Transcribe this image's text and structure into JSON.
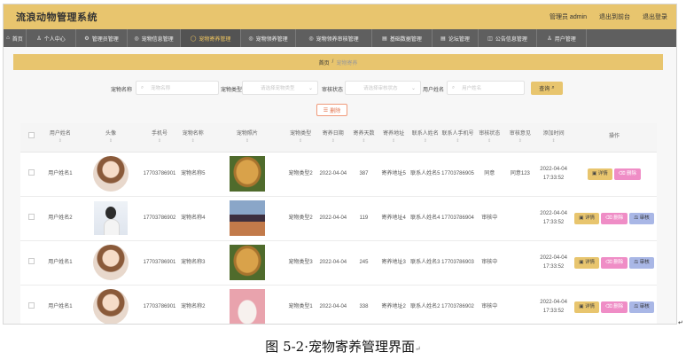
{
  "header": {
    "title": "流浪动物管理系统",
    "role_user": "管理员 admin",
    "back_front": "退出到前台",
    "logout": "退出登录"
  },
  "nav": [
    {
      "icon": "home-icon",
      "glyph": "⌂",
      "label": "首页"
    },
    {
      "icon": "user-icon",
      "glyph": "♙",
      "label": "个人中心"
    },
    {
      "icon": "settings-icon",
      "glyph": "⚙",
      "label": "管理员管理"
    },
    {
      "icon": "info-icon",
      "glyph": "◎",
      "label": "宠物信息管理"
    },
    {
      "icon": "boarding-icon",
      "glyph": "◯",
      "label": "宠物寄养管理"
    },
    {
      "icon": "adopt-icon",
      "glyph": "◎",
      "label": "宠物领养管理"
    },
    {
      "icon": "review-icon",
      "glyph": "◎",
      "label": "宠物领养审核管理"
    },
    {
      "icon": "data-icon",
      "glyph": "▤",
      "label": "基础数据管理"
    },
    {
      "icon": "forum-icon",
      "glyph": "▤",
      "label": "论坛管理"
    },
    {
      "icon": "notice-icon",
      "glyph": "◫",
      "label": "公告信息管理"
    },
    {
      "icon": "users-icon",
      "glyph": "♙",
      "label": "用户管理"
    }
  ],
  "breadcrumb": {
    "home": "首页",
    "sep": "/",
    "current": "宠物寄养"
  },
  "search": {
    "pet_name_label": "宠物名称",
    "pet_name_placeholder": "宠物名称",
    "pet_type_label": "宠物类型",
    "pet_type_placeholder": "请选择宠物类型",
    "audit_label": "审核状态",
    "audit_placeholder": "请选择审核状态",
    "user_label": "用户姓名",
    "user_placeholder": "用户姓名",
    "query_button": "查询",
    "delete_button": "删除"
  },
  "table": {
    "columns": [
      "用户姓名",
      "头像",
      "手机号",
      "宠物名称",
      "宠物照片",
      "宠物类型",
      "寄养日期",
      "寄养天数",
      "寄养地址",
      "联系人姓名",
      "联系人手机号",
      "审核状态",
      "审核意见",
      "添加时间",
      "操作"
    ],
    "rows": [
      {
        "user": "用户姓名1",
        "avatar": "circle",
        "phone": "17703786901",
        "pet": "宠物名称5",
        "photo": "dog",
        "type": "宠物类型2",
        "date": "2022-04-04",
        "days": "387",
        "address": "寄养地址5",
        "contact": "联系人姓名5",
        "contact_phone": "17703786905",
        "status": "同意",
        "opinion": "同意123",
        "added": "2022-04-04 17:33:52",
        "actions": [
          "详情",
          "删除"
        ]
      },
      {
        "user": "用户姓名2",
        "avatar": "square",
        "phone": "17703786902",
        "pet": "宠物名称4",
        "photo": "city",
        "type": "宠物类型2",
        "date": "2022-04-04",
        "days": "119",
        "address": "寄养地址4",
        "contact": "联系人姓名4",
        "contact_phone": "17703786904",
        "status": "审核中",
        "opinion": "",
        "added": "2022-04-04 17:33:52",
        "actions": [
          "详情",
          "删除",
          "审核"
        ]
      },
      {
        "user": "用户姓名1",
        "avatar": "circle",
        "phone": "17703786901",
        "pet": "宠物名称3",
        "photo": "dog",
        "type": "宠物类型3",
        "date": "2022-04-04",
        "days": "245",
        "address": "寄养地址3",
        "contact": "联系人姓名3",
        "contact_phone": "17703786903",
        "status": "审核中",
        "opinion": "",
        "added": "2022-04-04 17:33:52",
        "actions": [
          "详情",
          "删除",
          "审核"
        ]
      },
      {
        "user": "用户姓名1",
        "avatar": "circle",
        "phone": "17703786901",
        "pet": "宠物名称2",
        "photo": "cats",
        "type": "宠物类型1",
        "date": "2022-04-04",
        "days": "338",
        "address": "寄养地址2",
        "contact": "联系人姓名2",
        "contact_phone": "17703786902",
        "status": "审核中",
        "opinion": "",
        "added": "2022-04-04 17:33:52",
        "actions": [
          "详情",
          "删除",
          "审核"
        ]
      }
    ]
  },
  "caption": "图 5-2·宠物寄养管理界面",
  "colors": {
    "accent": "#e8c56e",
    "nav_bg": "#5f5f5f",
    "delete": "#ef8dc6",
    "audit": "#a9b7e6"
  }
}
